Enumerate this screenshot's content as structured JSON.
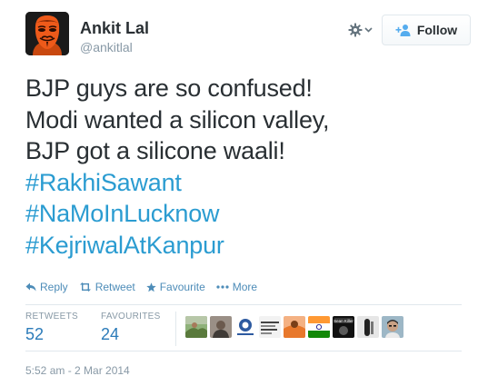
{
  "user": {
    "name": "Ankit Lal",
    "handle": "@ankitlal"
  },
  "header": {
    "follow_label": "Follow"
  },
  "tweet": {
    "lines": [
      "BJP guys are so confused!",
      "Modi wanted a silicon valley,",
      "BJP got a silicone waali!"
    ],
    "hashtags": [
      "#RakhiSawant",
      "#NaMoInLucknow",
      "#KejriwalAtKanpur"
    ]
  },
  "actions": {
    "reply": "Reply",
    "retweet": "Retweet",
    "favourite": "Favourite",
    "more": "More"
  },
  "stats": {
    "retweets_label": "RETWEETS",
    "retweets_count": "52",
    "favourites_label": "FAVOURITES",
    "favourites_count": "24"
  },
  "favoriter_avatars": {
    "tiny_text": [
      "Sean Killer"
    ]
  },
  "timestamp": "5:52 am - 2 Mar 2014",
  "colors": {
    "link": "#2b9cd1",
    "action": "#4d8cb8",
    "stat_value": "#2b7bb9",
    "muted": "#8899a6",
    "text": "#292f33",
    "border": "#e1e8ed"
  },
  "icons": {
    "avatar": "masked-face-avatar",
    "gear": "gear-icon",
    "follow": "add-user-icon",
    "reply": "reply-arrow-icon",
    "retweet": "retweet-icon",
    "favourite": "star-icon",
    "more": "three-dots-icon"
  }
}
